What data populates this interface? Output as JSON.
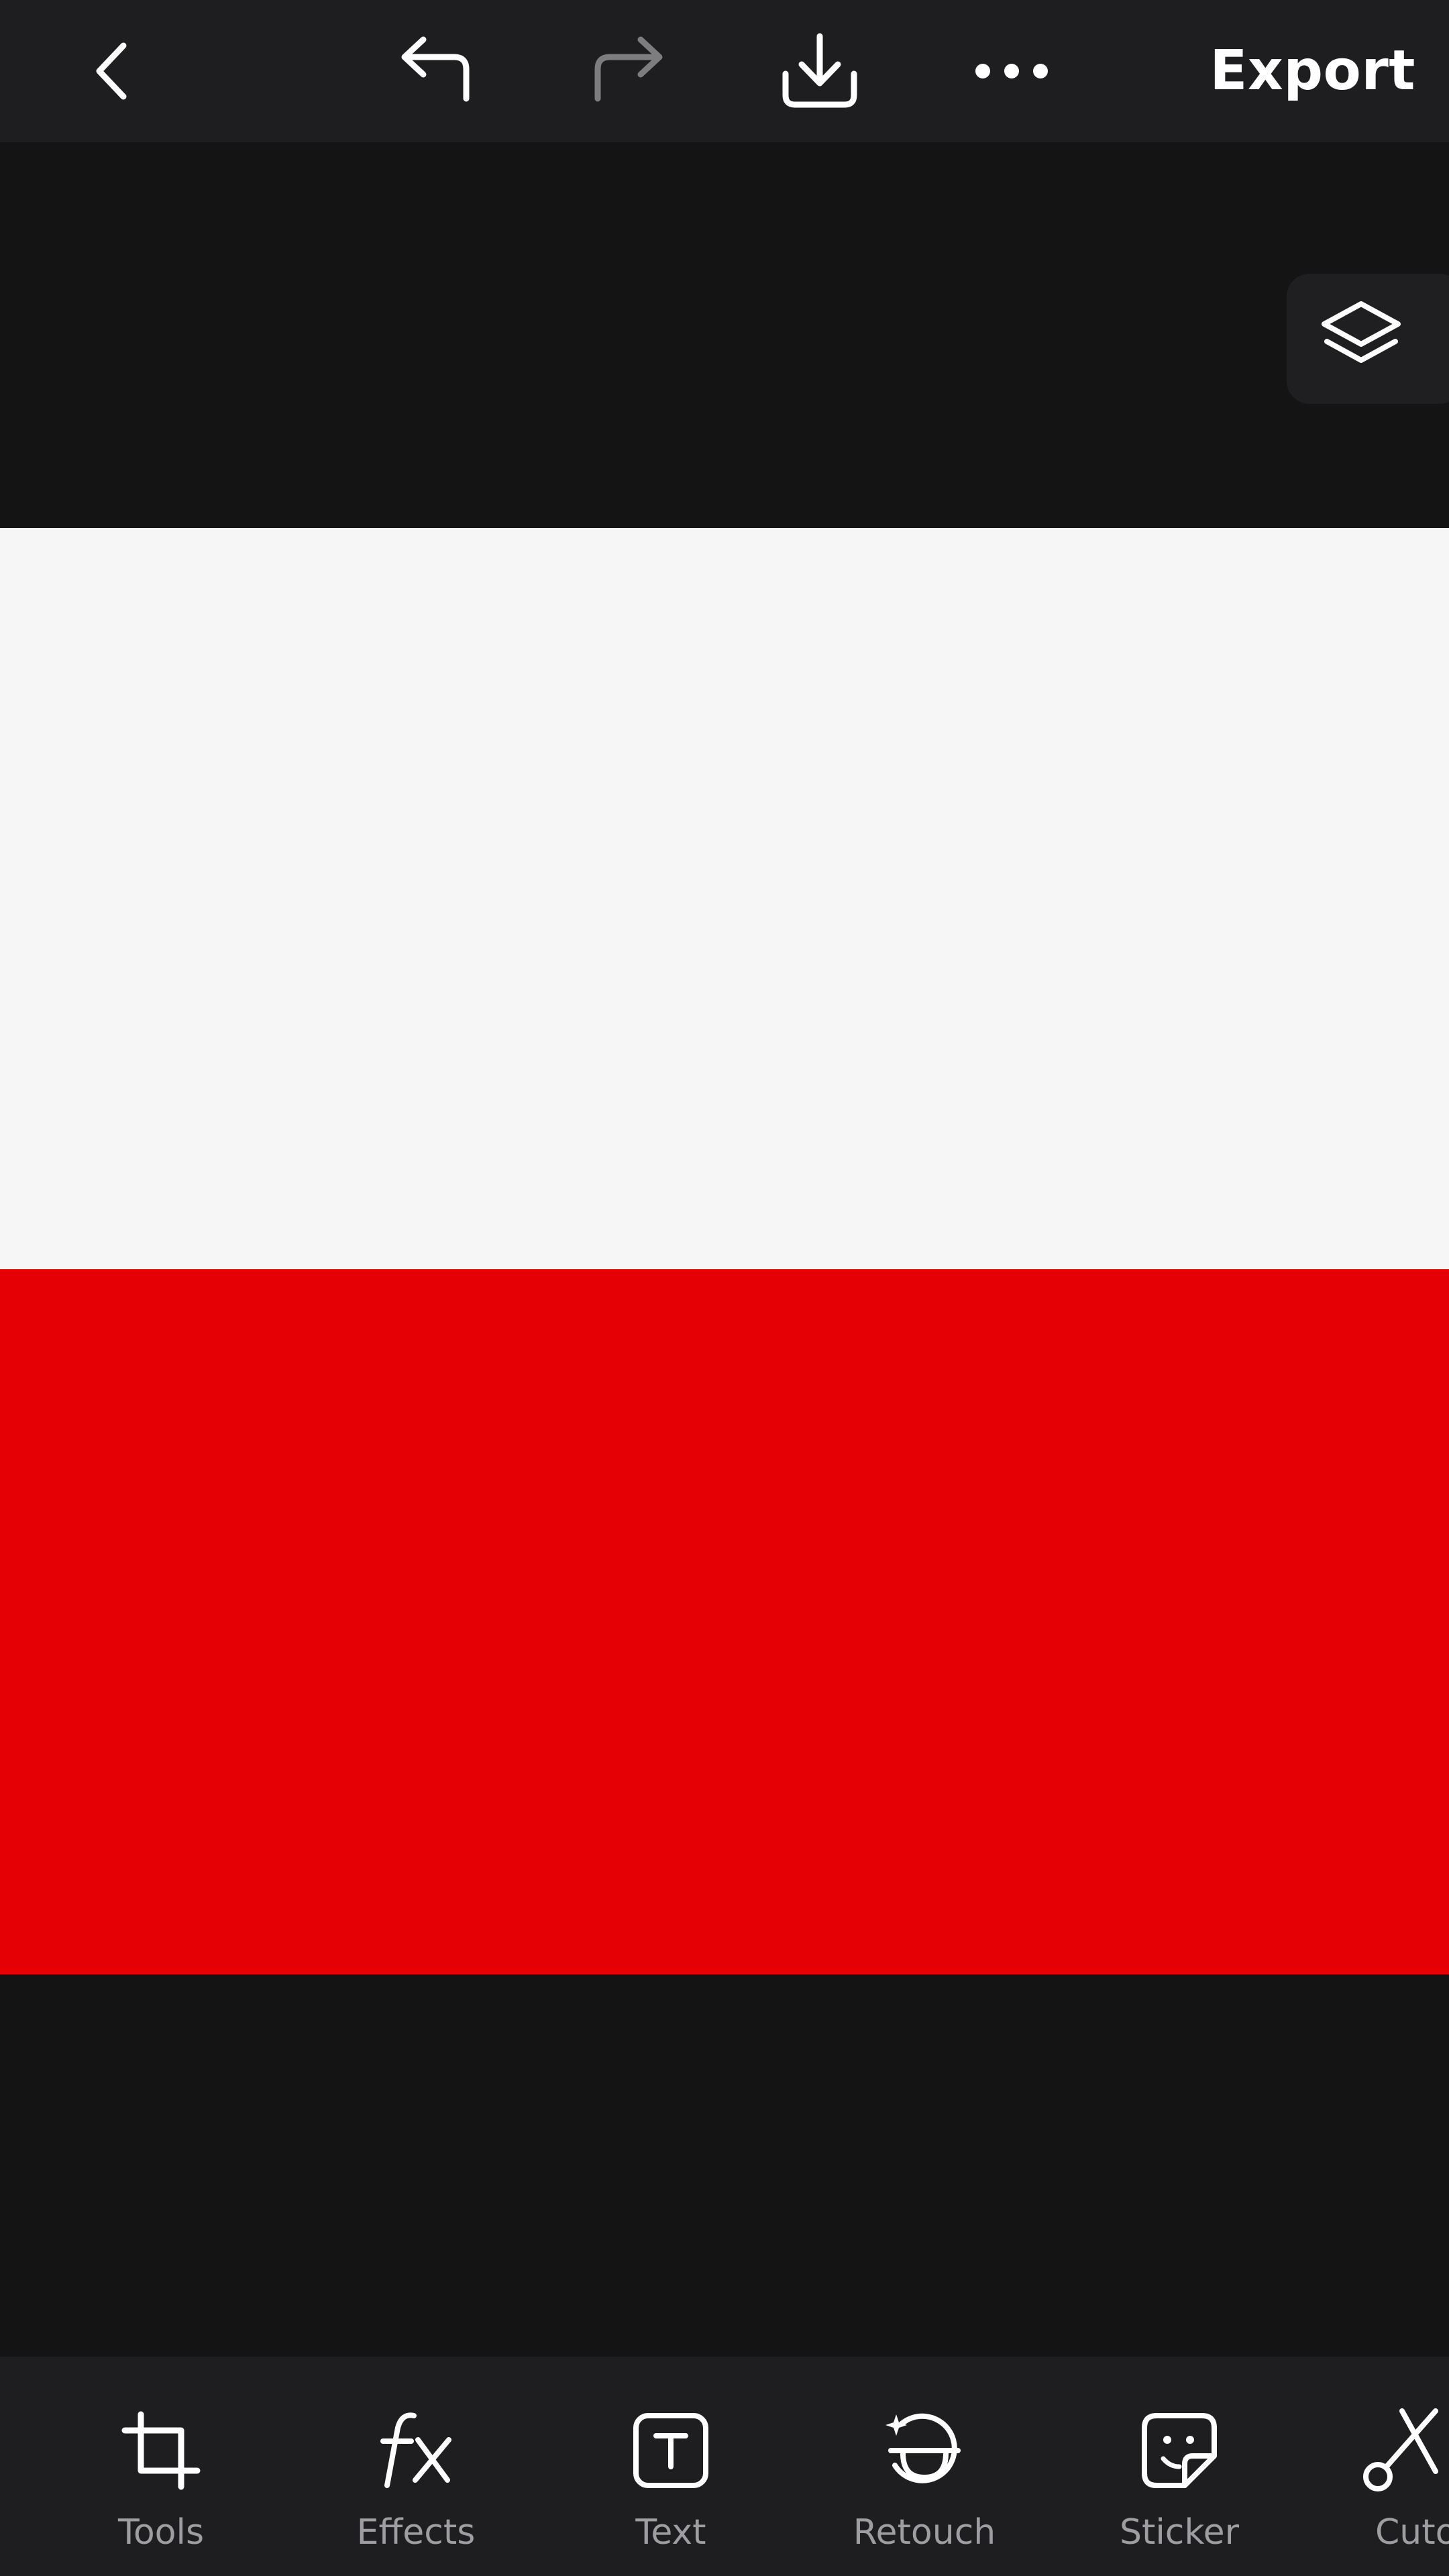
{
  "toolbar": {
    "back_icon": "chevron-left-icon",
    "undo_icon": "undo-icon",
    "redo_icon": "redo-icon",
    "download_icon": "download-icon",
    "more_icon": "more-horizontal-icon",
    "export_label": "Export"
  },
  "canvas": {
    "layers_icon": "layers-icon",
    "flag_colors": {
      "top": "#f7f6f7",
      "bottom": "#e50005"
    }
  },
  "tools": [
    {
      "label": "Tools",
      "icon": "crop-icon"
    },
    {
      "label": "Effects",
      "icon": "fx-icon"
    },
    {
      "label": "Text",
      "icon": "text-icon"
    },
    {
      "label": "Retouch",
      "icon": "retouch-icon"
    },
    {
      "label": "Sticker",
      "icon": "sticker-icon"
    },
    {
      "label": "Cuto",
      "icon": "scissors-icon"
    }
  ],
  "colors": {
    "background": "#141415",
    "toolbar": "#1e1e20",
    "label": "#9e9ea2",
    "disabled_icon": "#7d7d80"
  }
}
